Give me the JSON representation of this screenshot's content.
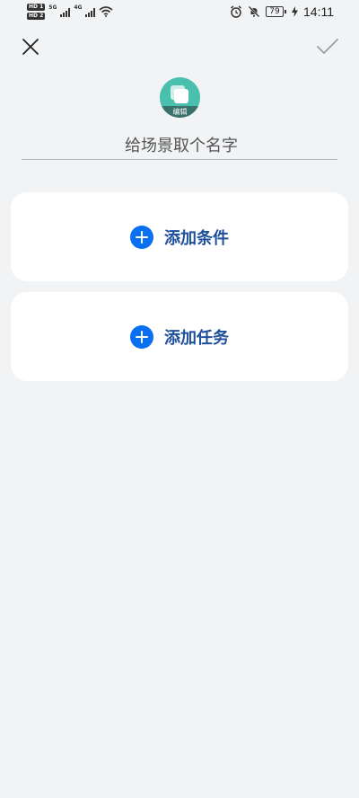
{
  "status_bar": {
    "hd_top": "HD 1",
    "hd_bottom": "HD 2",
    "network_1": "5G",
    "network_2": "4G",
    "battery_level": "79",
    "time": "14:11"
  },
  "header": {
    "close_icon": "close-icon",
    "confirm_icon": "check-icon"
  },
  "scene": {
    "edit_label": "编辑",
    "name_placeholder": "给场景取个名字",
    "name_value": ""
  },
  "cards": {
    "add_condition_label": "添加条件",
    "add_task_label": "添加任务"
  },
  "colors": {
    "background": "#f1f3f5",
    "accent_blue": "#0a70f2",
    "label_blue": "#1d4f9c",
    "scene_icon_teal": "#49c0ad"
  }
}
